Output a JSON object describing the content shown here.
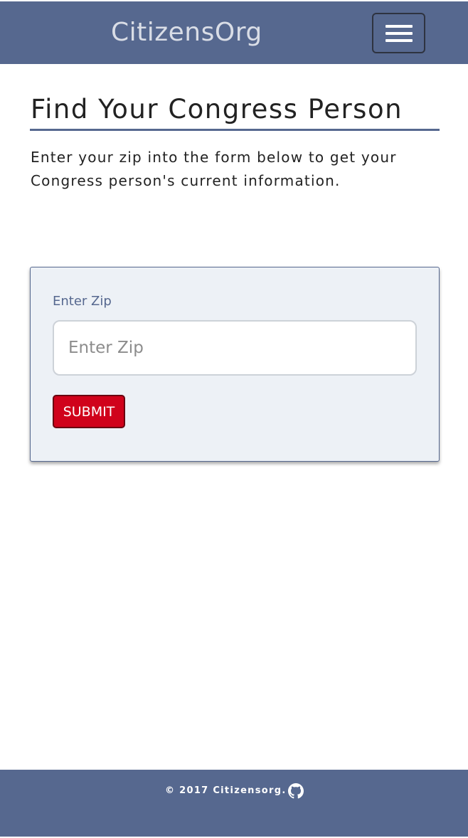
{
  "header": {
    "brand": "CitizensOrg",
    "menu_icon": "hamburger-icon"
  },
  "main": {
    "title": "Find Your Congress Person",
    "intro": "Enter your zip into the form below to get your Congress person's current information."
  },
  "form": {
    "zip_label": "Enter Zip",
    "zip_value": "",
    "zip_placeholder": "Enter Zip",
    "submit_label": "SUBMIT"
  },
  "footer": {
    "copyright": "© 2017 Citizensorg.",
    "github_icon": "github-icon"
  },
  "colors": {
    "brand_blue": "#56688f",
    "card_background": "#edf1f6",
    "submit_red": "#d0021b"
  }
}
